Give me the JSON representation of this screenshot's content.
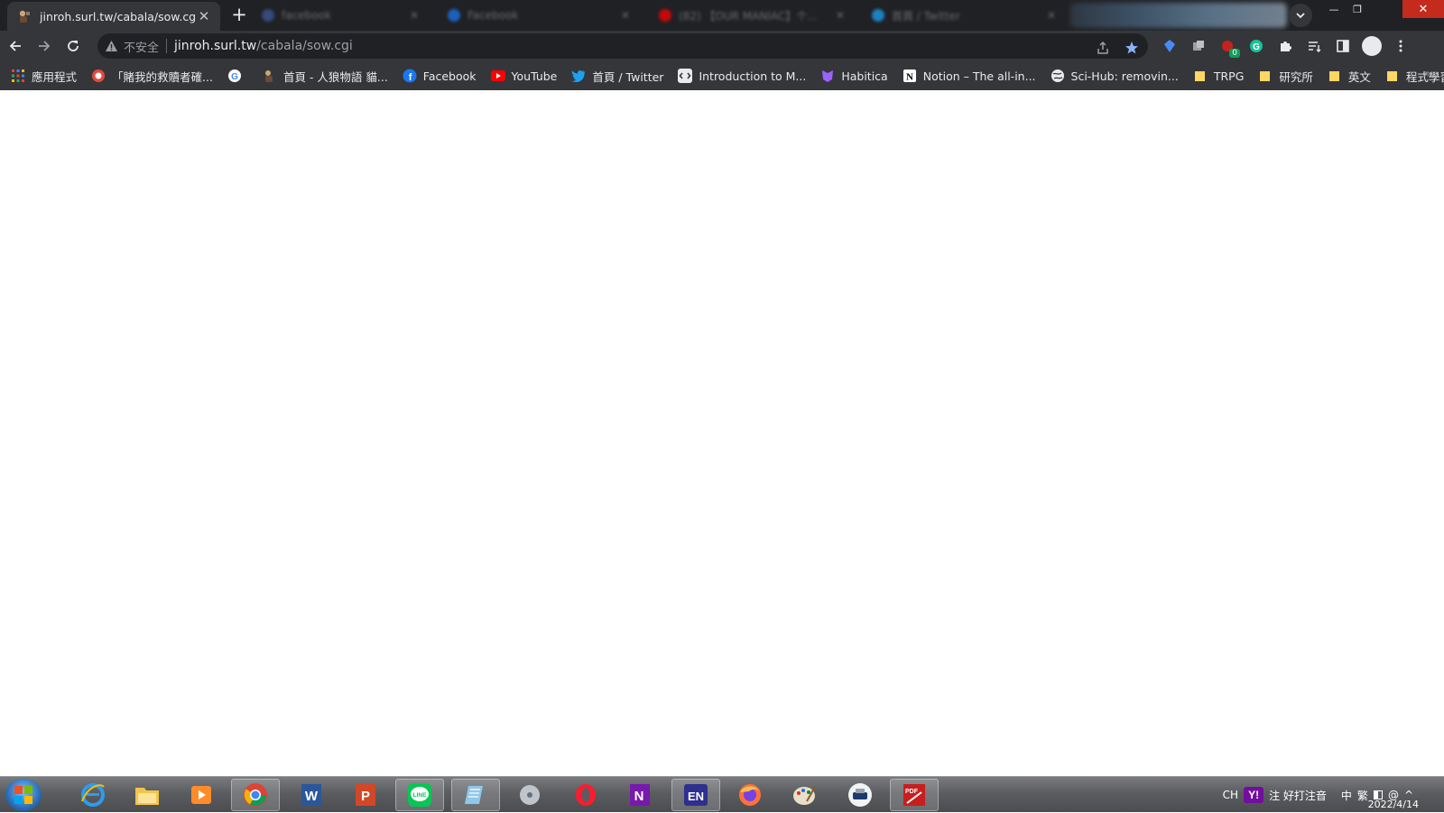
{
  "tabs": {
    "active": {
      "title": "jinroh.surl.tw/cabala/sow.cgi",
      "close": "✕"
    },
    "new_tab": "+",
    "background": [
      {
        "title": "facebook",
        "favicon_color": "#3b5998"
      },
      {
        "title": "Facebook",
        "favicon_color": "#1877f2"
      },
      {
        "title": "(82) 【OUR MANIAC】个...",
        "favicon_color": "#ff0000"
      },
      {
        "title": "首頁 / Twitter",
        "favicon_color": "#1da1f2"
      }
    ]
  },
  "window": {
    "minimize": "—",
    "maximize": "❐",
    "close": "✕"
  },
  "toolbar": {
    "security_label": "不安全",
    "url_host": "jinroh.surl.tw",
    "url_path": "/cabala/sow.cgi",
    "extension_badge": "0"
  },
  "bookmarks": [
    {
      "label": "應用程式",
      "icon": "apps-grid-icon"
    },
    {
      "label": "「賭我的救贖者確...",
      "icon": "red-face-icon"
    },
    {
      "label": "",
      "icon": "google-icon"
    },
    {
      "label": "首頁 - 人狼物語 貓...",
      "icon": "jinroh-icon"
    },
    {
      "label": "Facebook",
      "icon": "facebook-icon"
    },
    {
      "label": "YouTube",
      "icon": "youtube-icon"
    },
    {
      "label": "首頁 / Twitter",
      "icon": "twitter-icon"
    },
    {
      "label": "Introduction to M...",
      "icon": "code-icon"
    },
    {
      "label": "Habitica",
      "icon": "habitica-icon"
    },
    {
      "label": "Notion – The all-in...",
      "icon": "notion-icon"
    },
    {
      "label": "Sci-Hub: removin...",
      "icon": "globe-icon"
    },
    {
      "label": "TRPG",
      "icon": "folder-icon"
    },
    {
      "label": "研究所",
      "icon": "folder-icon"
    },
    {
      "label": "英文",
      "icon": "folder-icon"
    },
    {
      "label": "程式學習",
      "icon": "folder-icon"
    }
  ],
  "taskbar": {
    "apps": [
      {
        "name": "ie",
        "letter": "e"
      },
      {
        "name": "explorer",
        "letter": ""
      },
      {
        "name": "media-player",
        "letter": ""
      },
      {
        "name": "chrome",
        "letter": ""
      },
      {
        "name": "word",
        "letter": "W"
      },
      {
        "name": "powerpoint",
        "letter": "P"
      },
      {
        "name": "line",
        "letter": "LINE"
      },
      {
        "name": "notepad",
        "letter": ""
      },
      {
        "name": "disc",
        "letter": ""
      },
      {
        "name": "opera",
        "letter": "O"
      },
      {
        "name": "onenote",
        "letter": "N"
      },
      {
        "name": "en-dictionary",
        "letter": "EN"
      },
      {
        "name": "firefox",
        "letter": ""
      },
      {
        "name": "paint",
        "letter": ""
      },
      {
        "name": "printer",
        "letter": ""
      },
      {
        "name": "pdf",
        "letter": "PDF"
      }
    ],
    "tray": {
      "lang": "CH",
      "yahoo": "Y!",
      "ime": "注 好打注音",
      "mode1": "中",
      "mode2": "繁",
      "date": "2022/4/14"
    }
  }
}
